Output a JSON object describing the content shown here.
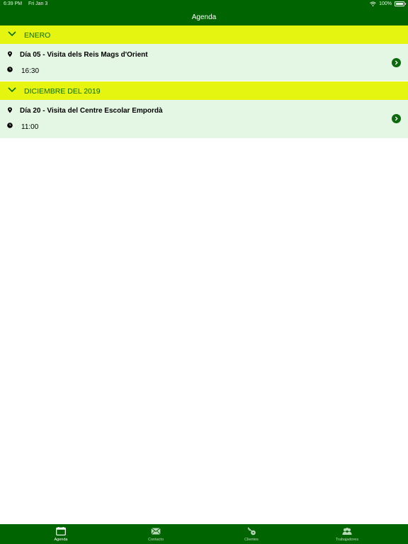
{
  "status_bar": {
    "time": "6:39 PM",
    "date": "Fri Jan 3",
    "battery": "100%"
  },
  "nav": {
    "title": "Agenda"
  },
  "sections": [
    {
      "title": "ENERO",
      "events": [
        {
          "title": "Día 05 - Visita dels Reis Mags d'Orient",
          "time": "16:30"
        }
      ]
    },
    {
      "title": "DICIEMBRE DEL 2019",
      "events": [
        {
          "title": "Día 20 - Visita del Centre Escolar Empordà",
          "time": "11:00"
        }
      ]
    }
  ],
  "tabs": [
    {
      "label": "Agenda",
      "icon": "calendar-icon",
      "active": true
    },
    {
      "label": "Contacto",
      "icon": "envelope-icon",
      "active": false
    },
    {
      "label": "Clientes",
      "icon": "key-icon",
      "active": false
    },
    {
      "label": "Trabajadores",
      "icon": "people-icon",
      "active": false
    }
  ],
  "colors": {
    "primary": "#006400",
    "section": "#e6f50f",
    "row": "#e4f7e4"
  }
}
